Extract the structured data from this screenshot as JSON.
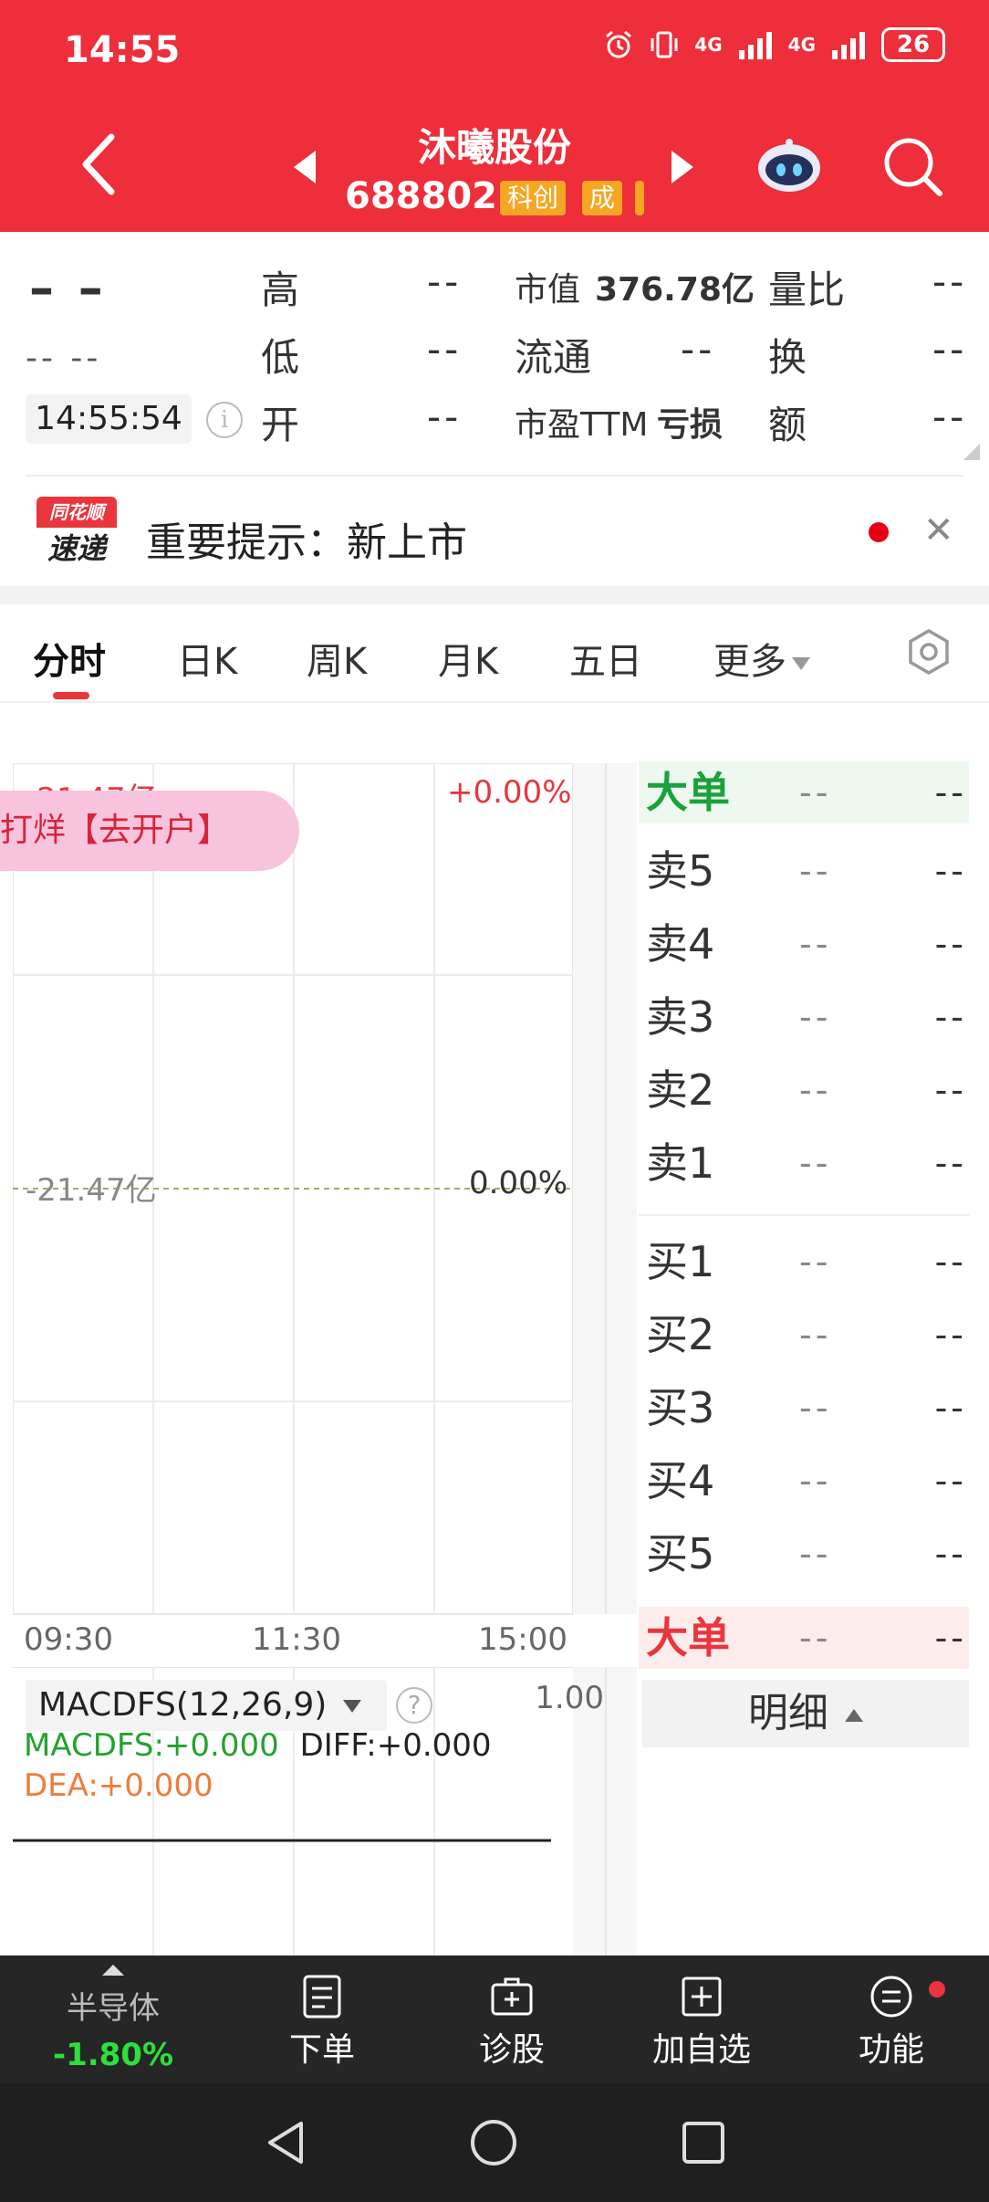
{
  "status_bar": {
    "time": "14:55",
    "network_1": "4G",
    "network_2": "4G",
    "battery": "26"
  },
  "header": {
    "stock_name": "沐曦股份",
    "stock_code": "688802",
    "badge_1": "科创",
    "badge_2": "成"
  },
  "quote": {
    "price": "– –",
    "change": "-- --",
    "time": "14:55:54",
    "high_label": "高",
    "high_value": "--",
    "low_label": "低",
    "low_value": "--",
    "open_label": "开",
    "open_value": "--",
    "mktcap_label": "市值",
    "mktcap_value": "376.78亿",
    "float_label": "流通",
    "float_value": "--",
    "pe_label": "市盈TTM",
    "pe_value": "亏损",
    "vol_ratio_label": "量比",
    "vol_ratio_value": "--",
    "turnover_label": "换",
    "turnover_value": "--",
    "amount_label": "额",
    "amount_value": "--"
  },
  "notice": {
    "logo_top": "同花顺",
    "logo_bottom": "速递",
    "text": "重要提示：新上市"
  },
  "tabs": [
    {
      "label": "分时",
      "active": true
    },
    {
      "label": "日K"
    },
    {
      "label": "周K"
    },
    {
      "label": "月K"
    },
    {
      "label": "五日"
    },
    {
      "label": "更多"
    }
  ],
  "chart": {
    "top_left": "-21.47亿",
    "top_right": "+0.00%",
    "mid_left": "-21.47亿",
    "mid_right": "0.00%",
    "promo": "打烊【去开户】",
    "times": [
      "09:30",
      "11:30",
      "15:00"
    ],
    "colors": {
      "up": "#e8363c",
      "grid": "#e6e6e6",
      "baseline": "#a8a86a"
    }
  },
  "order_book": {
    "big_top": {
      "label": "大单",
      "price": "--",
      "vol": "--"
    },
    "sell": [
      {
        "label": "卖5",
        "price": "--",
        "vol": "--"
      },
      {
        "label": "卖4",
        "price": "--",
        "vol": "--"
      },
      {
        "label": "卖3",
        "price": "--",
        "vol": "--"
      },
      {
        "label": "卖2",
        "price": "--",
        "vol": "--"
      },
      {
        "label": "卖1",
        "price": "--",
        "vol": "--"
      }
    ],
    "buy": [
      {
        "label": "买1",
        "price": "--",
        "vol": "--"
      },
      {
        "label": "买2",
        "price": "--",
        "vol": "--"
      },
      {
        "label": "买3",
        "price": "--",
        "vol": "--"
      },
      {
        "label": "买4",
        "price": "--",
        "vol": "--"
      },
      {
        "label": "买5",
        "price": "--",
        "vol": "--"
      }
    ],
    "big_bottom": {
      "label": "大单",
      "price": "--",
      "vol": "--"
    },
    "detail_label": "明细"
  },
  "macd": {
    "selector": "MACDFS(12,26,9)",
    "scale": "1.00",
    "macdfs_label": "MACDFS:",
    "macdfs_value": "+0.000",
    "diff_label": "DIFF:",
    "diff_value": "+0.000",
    "dea_label": "DEA:",
    "dea_value": "+0.000",
    "colors": {
      "macdfs": "#22a22e",
      "diff": "#222222",
      "dea": "#ee7c3a"
    }
  },
  "bottom_bar": {
    "sector_name": "半导体",
    "sector_pct": "-1.80%",
    "order": "下单",
    "diagnose": "诊股",
    "add_watch": "加自选",
    "functions": "功能"
  }
}
